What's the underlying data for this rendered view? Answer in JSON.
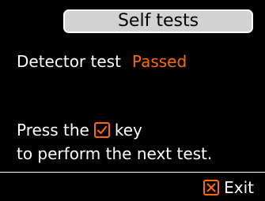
{
  "header": {
    "title": "Self tests"
  },
  "test": {
    "label": "Detector test",
    "status": "Passed"
  },
  "instruction": {
    "prefix": "Press the",
    "suffix": "key",
    "line2": "to perform the next test.",
    "key_icon": "checkbox-check-icon"
  },
  "footer": {
    "exit_label": "Exit",
    "exit_icon": "close-box-icon"
  },
  "colors": {
    "accent": "#ff6a00",
    "title_bg": "#d2d2d2",
    "background": "#000000",
    "text": "#ffffff"
  }
}
